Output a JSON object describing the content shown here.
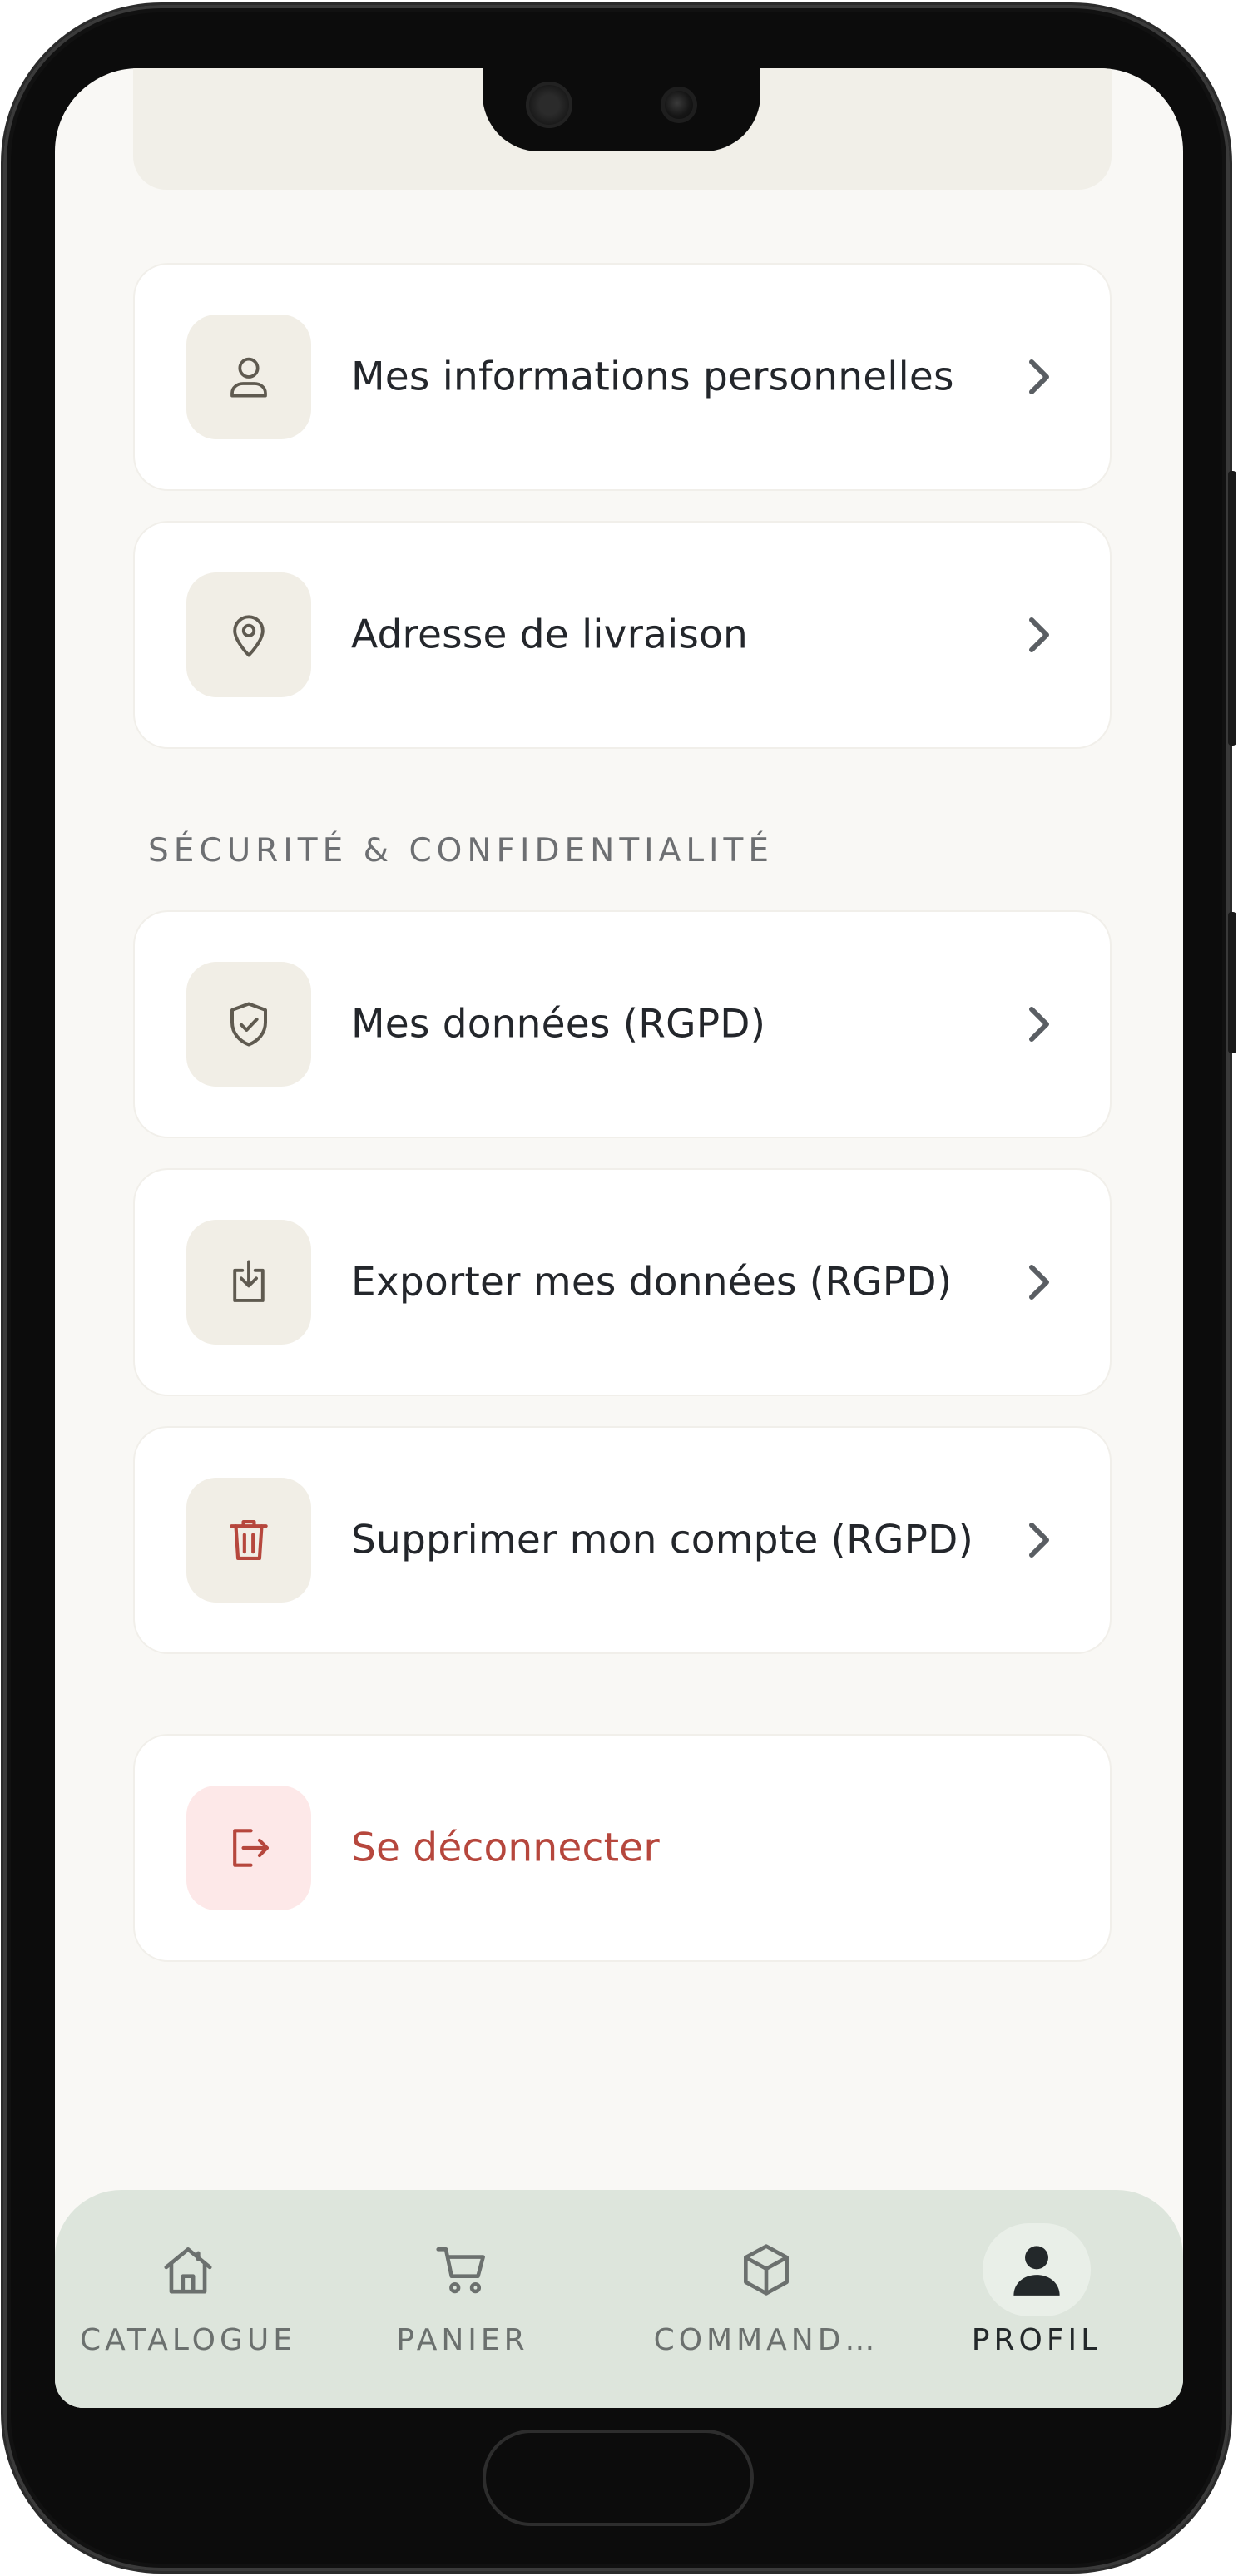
{
  "menu": {
    "items": [
      {
        "label": "Mes informations personnelles",
        "icon": "user-icon"
      },
      {
        "label": "Adresse de livraison",
        "icon": "location-pin-icon"
      }
    ]
  },
  "security": {
    "section_title": "SÉCURITÉ & CONFIDENTIALITÉ",
    "items": [
      {
        "label": "Mes données (RGPD)",
        "icon": "shield-check-icon"
      },
      {
        "label": "Exporter mes données (RGPD)",
        "icon": "download-icon"
      },
      {
        "label": "Supprimer mon compte (RGPD)",
        "icon": "trash-icon"
      }
    ]
  },
  "logout": {
    "label": "Se déconnecter",
    "icon": "logout-icon"
  },
  "bottom_nav": {
    "items": [
      {
        "label": "CATALOGUE",
        "icon": "home-icon",
        "active": false
      },
      {
        "label": "PANIER",
        "icon": "cart-icon",
        "active": false
      },
      {
        "label": "COMMAND…",
        "icon": "box-icon",
        "active": false
      },
      {
        "label": "PROFIL",
        "icon": "person-icon",
        "active": true
      }
    ]
  },
  "colors": {
    "background": "#f9f8f5",
    "card": "#ffffff",
    "icon_box": "#f1eee6",
    "danger": "#b6473d",
    "danger_bg": "#fde8e8",
    "nav_bg": "#dde5dc",
    "text": "#23262b",
    "muted": "#6d6f72"
  }
}
